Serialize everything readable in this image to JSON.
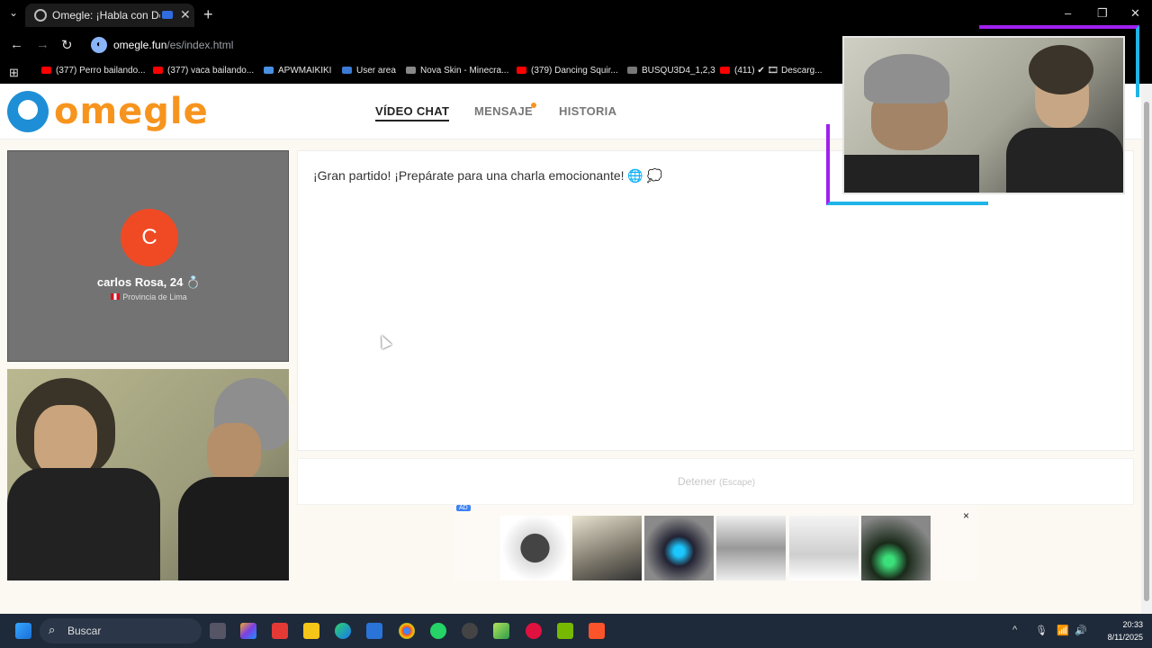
{
  "browser": {
    "tab_title": "Omegle: ¡Habla con Descon",
    "tab_close": "✕",
    "new_tab": "+",
    "tab_menu": "⌄",
    "url_host": "omegle.fun",
    "url_path": "/es/index.html",
    "window": {
      "minimize": "–",
      "restore": "❐",
      "close": "✕"
    },
    "bookmarks": [
      "(377) Perro bailando...",
      "(377) vaca bailando...",
      "APWMAIKIKI",
      "User area",
      "Nova Skin - Minecra...",
      "(379) Dancing Squir...",
      "BUSQU3D4_1,2,3",
      "(411) ✔ 🎞 Descarg..."
    ]
  },
  "site": {
    "logo_text": "omegle",
    "nav": {
      "video_chat": "VÍDEO CHAT",
      "message": "MENSAJE",
      "history": "HISTORIA"
    },
    "profile": {
      "initial": "C",
      "name": "carlos Rosa, 24 💍",
      "location": "Provincia de Lima"
    },
    "chat_message": "¡Gran partido! ¡Prepárate para una charla emocionante! 🌐 💭",
    "stop_label": "Detener",
    "stop_key": "(Escape)",
    "ad_badge": "AD",
    "ad_close": "×",
    "ad_products": [
      "smartwatch",
      "keyboard",
      "led-rings",
      "monitor-arm",
      "shoes",
      "bracelets"
    ]
  },
  "taskbar": {
    "search_label": "Buscar",
    "time": "20:33",
    "date": "8/11/2025"
  },
  "colors": {
    "brand_orange": "#f7941e",
    "brand_blue": "#1e8fd6",
    "avatar": "#f04a24",
    "overlay_purple": "#a020f0",
    "overlay_cyan": "#1fb5e8"
  }
}
